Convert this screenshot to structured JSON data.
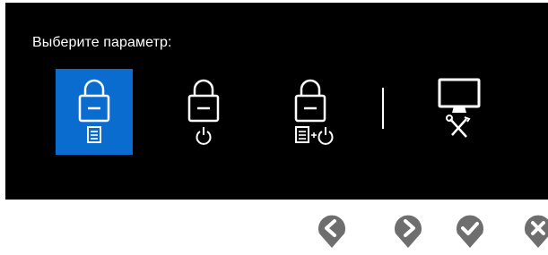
{
  "osd": {
    "prompt": "Выберите параметр:",
    "options": [
      {
        "icon": "lock-menu-icon",
        "selected": true
      },
      {
        "icon": "lock-power-icon",
        "selected": false
      },
      {
        "icon": "lock-menu-power-icon",
        "selected": false
      },
      {
        "icon": "monitor-settings-icon",
        "selected": false
      }
    ],
    "colors": {
      "background": "#000000",
      "selected": "#0a6ccf",
      "foreground": "#ffffff",
      "button": "#6e6e6e"
    }
  },
  "buttons": [
    "previous-icon",
    "next-icon",
    "confirm-icon",
    "exit-icon"
  ]
}
